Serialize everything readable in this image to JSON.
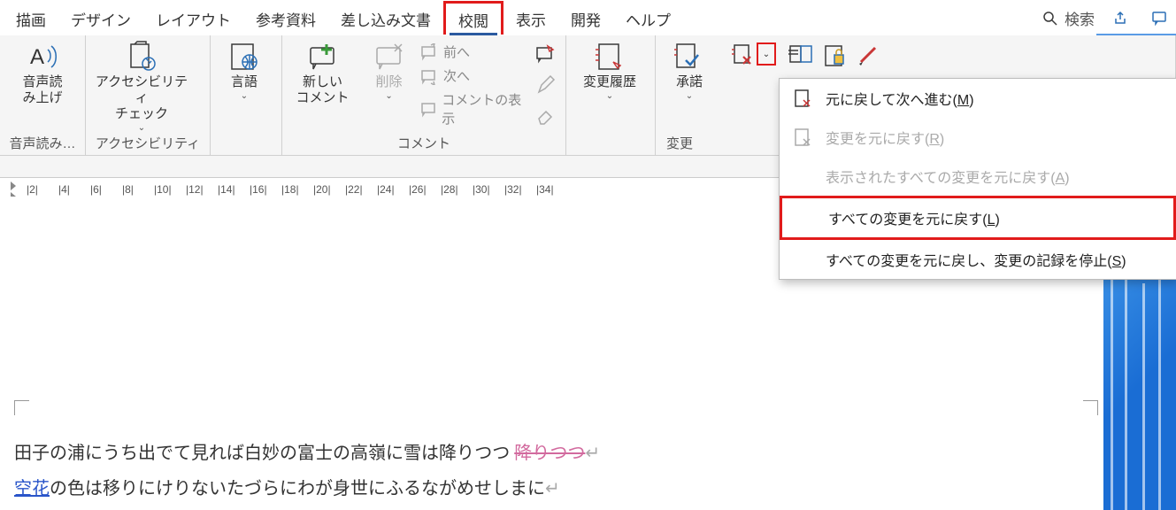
{
  "tabs": {
    "items": [
      "描画",
      "デザイン",
      "レイアウト",
      "参考資料",
      "差し込み文書",
      "校閲",
      "表示",
      "開発",
      "ヘルプ"
    ],
    "active_index": 5,
    "search_label": "検索"
  },
  "ribbon": {
    "groups": {
      "speech": {
        "label": "音声読み…",
        "button": "音声読\nみ上げ"
      },
      "accessibility": {
        "label": "アクセシビリティ",
        "button": "アクセシビリティ\nチェック"
      },
      "language": {
        "label": "",
        "button": "言語"
      },
      "comments": {
        "label": "コメント",
        "new": "新しい\nコメント",
        "delete": "削除",
        "prev": "前へ",
        "next": "次へ",
        "show": "コメントの表示"
      },
      "tracking": {
        "label": "変更",
        "track": "変更履歴",
        "accept": "承諾"
      }
    },
    "reject_menu": {
      "items": [
        {
          "label": "元に戻して次へ進む",
          "accel": "M",
          "enabled": true
        },
        {
          "label": "変更を元に戻す",
          "accel": "R",
          "enabled": false
        },
        {
          "label": "表示されたすべての変更を元に戻す",
          "accel": "A",
          "enabled": false
        },
        {
          "label": "すべての変更を元に戻す",
          "accel": "L",
          "enabled": true,
          "highlight": true
        },
        {
          "label": "すべての変更を元に戻し、変更の記録を停止",
          "accel": "S",
          "enabled": true
        }
      ]
    }
  },
  "ruler": {
    "ticks": [
      2,
      4,
      6,
      8,
      10,
      12,
      14,
      16,
      18,
      20,
      22,
      24,
      26,
      28,
      30,
      32,
      34
    ]
  },
  "document": {
    "line1_a": "田子の浦にうち出でて見れば白妙の富士の高嶺に雪は降りつつ",
    "line1_ins": "降りつつ",
    "line2_del": "空花",
    "line2_b": "の色は移りにけりないたづらにわが身世にふるながめせしまに"
  }
}
